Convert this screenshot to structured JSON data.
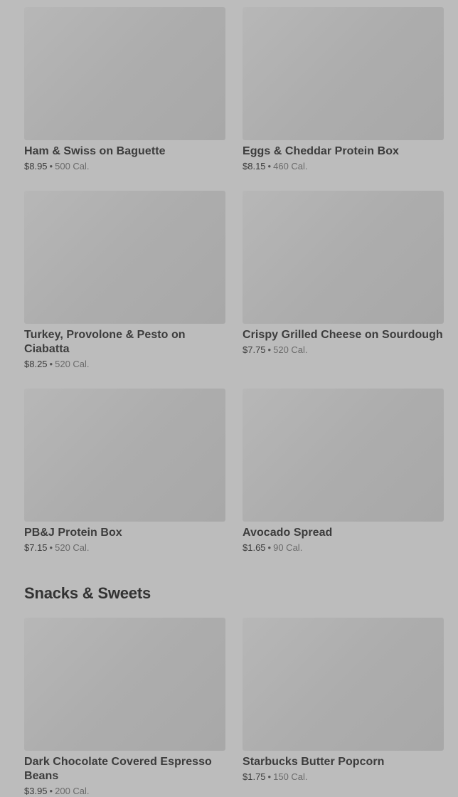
{
  "items": [
    {
      "name": "Ham & Swiss on Baguette",
      "price": "$8.95",
      "sep": "•",
      "calories": "500 Cal."
    },
    {
      "name": "Eggs & Cheddar Protein Box",
      "price": "$8.15",
      "sep": "•",
      "calories": "460 Cal."
    },
    {
      "name": "Turkey, Provolone & Pesto on Ciabatta",
      "price": "$8.25",
      "sep": "•",
      "calories": "520 Cal."
    },
    {
      "name": "Crispy Grilled Cheese on Sourdough",
      "price": "$7.75",
      "sep": "•",
      "calories": "520 Cal."
    },
    {
      "name": "PB&J Protein Box",
      "price": "$7.15",
      "sep": "•",
      "calories": "520 Cal."
    },
    {
      "name": "Avocado Spread",
      "price": "$1.65",
      "sep": "•",
      "calories": "90 Cal."
    }
  ],
  "snacks_section": {
    "title": "Snacks & Sweets",
    "items": [
      {
        "name": "Dark Chocolate Covered Espresso Beans",
        "price": "$3.95",
        "sep": "•",
        "calories": "200 Cal."
      },
      {
        "name": "Starbucks Butter Popcorn",
        "price": "$1.75",
        "sep": "•",
        "calories": "150 Cal."
      }
    ]
  }
}
